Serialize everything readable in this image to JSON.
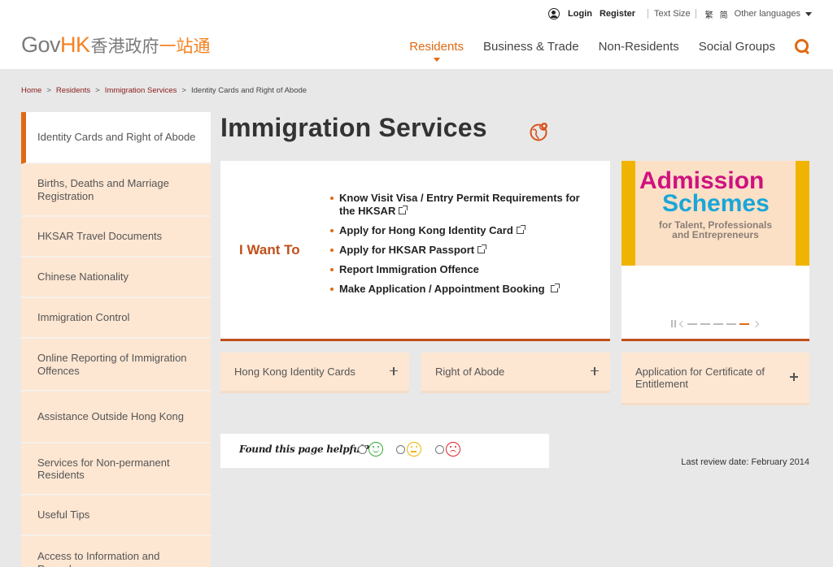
{
  "topbar": {
    "login": "Login",
    "register": "Register",
    "text_size": "Text Size",
    "lang_traditional": "繁",
    "lang_simplified": "简",
    "other_languages": "Other languages"
  },
  "logo": {
    "gov": "Gov",
    "hk": "HK",
    "zh_grey": "香港政府",
    "zh_orange": "一站通"
  },
  "nav": {
    "items": [
      {
        "label": "Residents"
      },
      {
        "label": "Business & Trade"
      },
      {
        "label": "Non-Residents"
      },
      {
        "label": "Social Groups"
      }
    ]
  },
  "breadcrumb": {
    "items": [
      {
        "label": "Home"
      },
      {
        "label": "Residents"
      },
      {
        "label": "Immigration Services"
      },
      {
        "label": "Identity Cards and Right of Abode"
      }
    ]
  },
  "sidebar": {
    "items": [
      {
        "label": "Identity Cards and Right of Abode"
      },
      {
        "label": "Births, Deaths and Marriage Registration"
      },
      {
        "label": "HKSAR Travel Documents"
      },
      {
        "label": "Chinese Nationality"
      },
      {
        "label": "Immigration Control"
      },
      {
        "label": "Online Reporting of Immigration Offences"
      },
      {
        "label": "Assistance Outside Hong Kong"
      },
      {
        "label": "Services for Non-permanent Residents"
      },
      {
        "label": "Useful Tips"
      },
      {
        "label": "Access to Information and Records"
      }
    ]
  },
  "main": {
    "title": "Immigration Services",
    "i_want_to": "I Want To",
    "actions": [
      {
        "label": "Know Visit Visa / Entry Permit Requirements for the HKSAR"
      },
      {
        "label": "Apply for Hong Kong Identity Card"
      },
      {
        "label": "Apply for HKSAR Passport"
      },
      {
        "label": "Report Immigration Offence"
      },
      {
        "label": "Make Application / Appointment Booking"
      }
    ],
    "banner": {
      "line1": "Admission",
      "line2": "Schemes",
      "line3": "for Talent, Professionals",
      "line4": "and Entrepreneurs"
    },
    "accordions": [
      {
        "label": "Hong Kong Identity Cards"
      },
      {
        "label": "Right of Abode"
      },
      {
        "label": "Application for Certificate of Entitlement"
      }
    ],
    "feedback_label": "Found this page helpful?",
    "review_date": "Last review date: February 2014"
  },
  "colors": {
    "accent": "#e06a13",
    "brand_orange": "#f58220",
    "dark_orange": "#c0501a",
    "sidebar_bg": "#fde6d2"
  }
}
